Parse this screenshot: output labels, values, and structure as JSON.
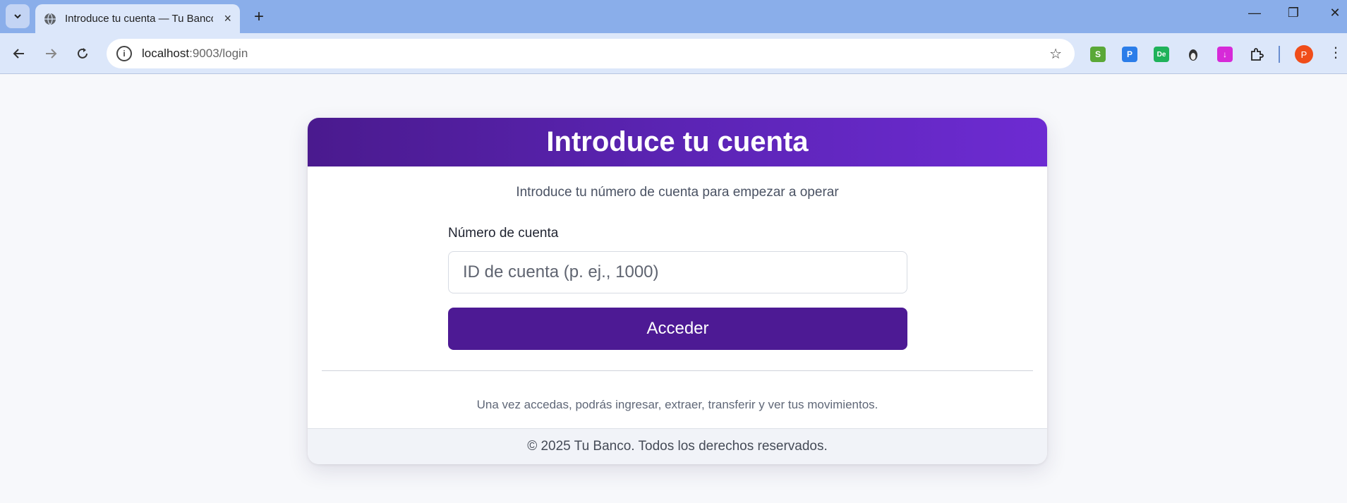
{
  "browser": {
    "tab_title": "Introduce tu cuenta — Tu Banco",
    "url_host": "localhost",
    "url_rest": ":9003/login",
    "new_tab_symbol": "+",
    "tab_close_symbol": "×",
    "profile_initial": "P",
    "extensions": [
      {
        "name": "shopify-icon",
        "label": "S",
        "color": "#5aa837"
      },
      {
        "name": "parking-icon",
        "label": "P",
        "color": "#2b7de9"
      },
      {
        "name": "de-icon",
        "label": "De",
        "color": "#1fb25a"
      },
      {
        "name": "penguin-icon",
        "label": "",
        "color": "#e8eef9"
      },
      {
        "name": "download-icon",
        "label": "↓",
        "color": "#d62ad8"
      }
    ],
    "window_controls": [
      "—",
      "❐",
      "✕"
    ]
  },
  "page": {
    "header_title": "Introduce tu cuenta",
    "subtitle": "Introduce tu número de cuenta para empezar a operar",
    "field_label": "Número de cuenta",
    "field_placeholder": "ID de cuenta (p. ej., 1000)",
    "field_value": "",
    "submit_label": "Acceder",
    "note": "Una vez accedas, podrás ingresar, extraer, transferir y ver tus movimientos.",
    "footer": "© 2025 Tu Banco. Todos los derechos reservados."
  },
  "colors": {
    "header_gradient_start": "#4a1a8e",
    "header_gradient_end": "#6d2bd2",
    "button": "#4d1a94"
  }
}
